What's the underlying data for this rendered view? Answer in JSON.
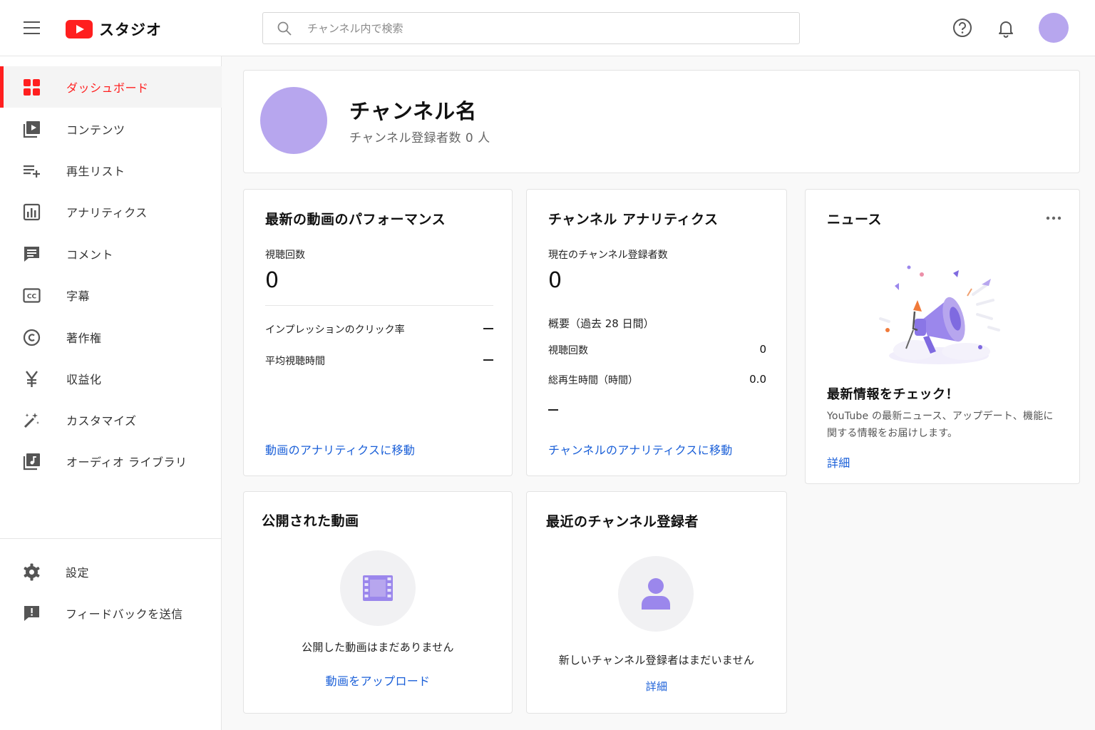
{
  "app": {
    "logo_text": "スタジオ"
  },
  "search": {
    "placeholder": "チャンネル内で検索"
  },
  "sidebar": {
    "items": [
      {
        "label": "ダッシュボード",
        "icon": "dashboard-icon",
        "active": true
      },
      {
        "label": "コンテンツ",
        "icon": "content-icon"
      },
      {
        "label": "再生リスト",
        "icon": "playlist-icon"
      },
      {
        "label": "アナリティクス",
        "icon": "analytics-icon"
      },
      {
        "label": "コメント",
        "icon": "comment-icon"
      },
      {
        "label": "字幕",
        "icon": "cc-icon"
      },
      {
        "label": "著作権",
        "icon": "copyright-icon"
      },
      {
        "label": "収益化",
        "icon": "yen-icon"
      },
      {
        "label": "カスタマイズ",
        "icon": "magic-wand-icon"
      },
      {
        "label": "オーディオ ライブラリ",
        "icon": "audio-library-icon"
      }
    ],
    "bottom_items": [
      {
        "label": "設定",
        "icon": "gear-icon"
      },
      {
        "label": "フィードバックを送信",
        "icon": "feedback-icon"
      }
    ]
  },
  "channel": {
    "name": "チャンネル名",
    "subscribers": "チャンネル登録者数 0 人"
  },
  "video_performance": {
    "title": "最新の動画のパフォーマンス",
    "views_label": "視聴回数",
    "views_value": "0",
    "ctr_label": "インプレッションのクリック率",
    "avg_label": "平均視聴時間",
    "link": "動画のアナリティクスに移動"
  },
  "channel_analytics": {
    "title": "チャンネル アナリティクス",
    "subs_label": "現在のチャンネル登録者数",
    "subs_value": "0",
    "summary_label": "概要（過去 28 日間）",
    "views_label": "視聴回数",
    "views_value": "0",
    "watch_label": "総再生時間（時間）",
    "watch_value": "0.0",
    "link": "チャンネルのアナリティクスに移動"
  },
  "news": {
    "title": "ニュース",
    "headline": "最新情報をチェック！",
    "body_1": "YouTube の最新ニュース、アップデート、機能に",
    "body_2": "関する情報をお届けします。",
    "link": "詳細"
  },
  "published_videos": {
    "title": "公開された動画",
    "empty": "公開した動画はまだありません",
    "link": "動画をアップロード"
  },
  "recent_subscribers": {
    "title": "最近のチャンネル登録者",
    "empty": "新しいチャンネル登録者はまだいません",
    "link": "詳細"
  },
  "colors": {
    "accent": "#ff1f1f",
    "link": "#1a5fd8",
    "avatar": "#b7a6ee",
    "illustration": "#9b87ec"
  }
}
